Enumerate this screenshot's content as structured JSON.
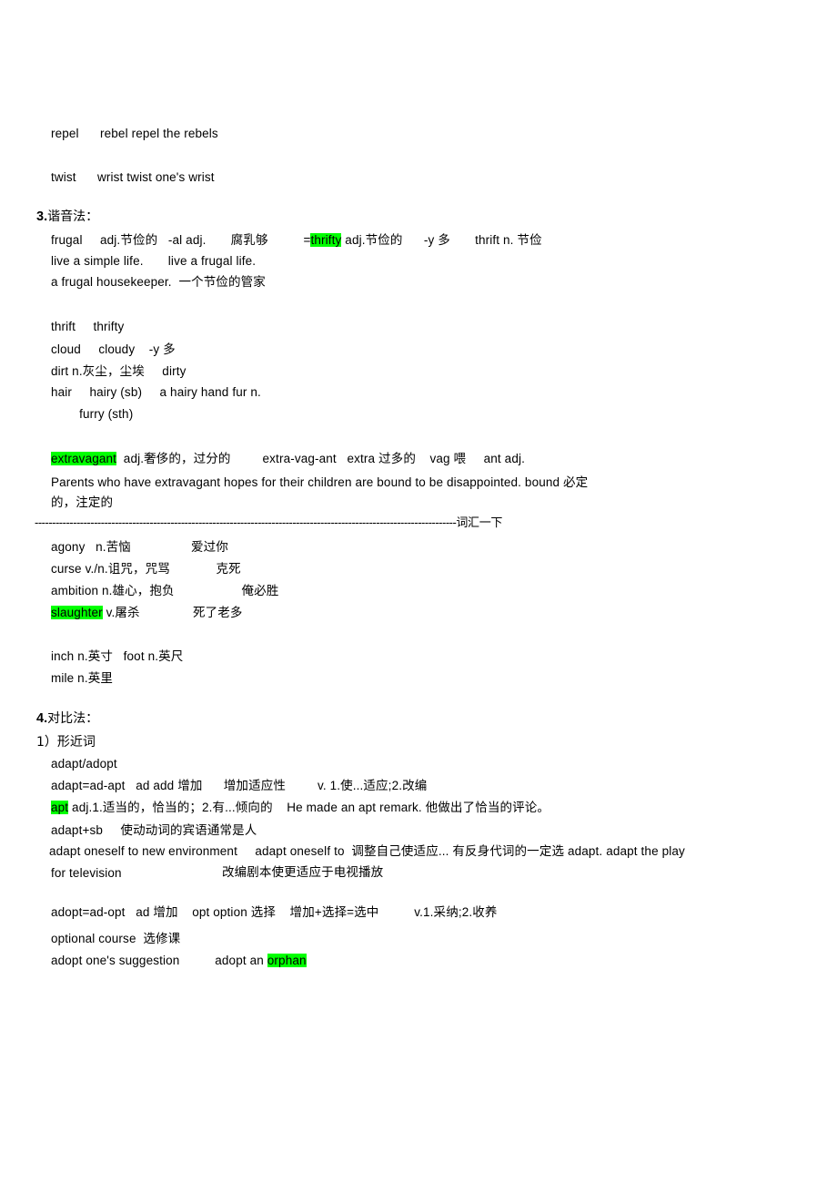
{
  "document": {
    "highlight_color": "#00ff00",
    "background": "#ffffff",
    "text_color": "#000000"
  },
  "lines": {
    "repel": "repel      rebel repel the rebels",
    "twist": "twist      wrist twist one's wrist",
    "heading3_num": "3.",
    "heading3_text": "谐音法：",
    "frugal_1a": "frugal     adj.节俭的   -al adj.       腐乳够          =",
    "frugal_1b": "thrifty",
    "frugal_1c": " adj.节俭的      -y 多       thrift n. 节俭",
    "frugal_2": "live a simple life.       live a frugal life.",
    "frugal_3": "a frugal housekeeper.  一个节俭的管家",
    "thrift_row": "thrift     thrifty",
    "cloud_row": "cloud     cloudy    -y 多",
    "dirt_row": "dirt n.灰尘，尘埃     dirty",
    "hair_row": "hair     hairy (sb)     a hairy hand fur n.",
    "furry_row": "        furry (sth)",
    "extravagant_hl": "extravagant",
    "extravagant_rest": "  adj.奢侈的，过分的         extra-vag-ant   extra 过多的    vag 喂     ant adj.",
    "extravagant_sent": "Parents who have extravagant hopes for their children are bound to be disappointed. bound 必定",
    "extravagant_sent2": "的，注定的",
    "separator_dashes": "-------------------------------------------------------------------------------------------------------------------------",
    "separator_label": "词汇一下",
    "agony": "agony   n.苦恼                 爱过你",
    "curse": "curse v./n.诅咒，咒骂             克死",
    "ambition": "ambition n.雄心，抱负                   俺必胜",
    "slaughter_hl": "slaughter",
    "slaughter_rest": " v.屠杀               死了老多",
    "inch": "inch n.英寸   foot n.英尺",
    "mile": "mile n.英里",
    "heading4_num": "4.",
    "heading4_text": "对比法：",
    "sub1": "1）形近词",
    "adapt_adopt": "adapt/adopt",
    "adapt_eq": "adapt=ad-apt   ad add 增加      增加适应性         v. 1.使...适应;2.改编",
    "apt_hl": "apt",
    "apt_rest": " adj.1.适当的，恰当的；2.有...倾向的    He made an apt remark. 他做出了恰当的评论。",
    "adapt_sb": "adapt+sb     使动动词的宾语通常是人",
    "adapt_oneself": "adapt oneself to new environment     adapt oneself to  调整自己使适应... 有反身代词的一定选 adapt. adapt the play",
    "for_television_a": "for television",
    "for_television_b": "改编剧本使更适应于电视播放",
    "adopt_eq": "adopt=ad-opt   ad 增加    opt option 选择    增加+选择=选中          v.1.采纳;2.收养",
    "optional_course": "optional course  选修课",
    "adopt_suggestion_a": "adopt one's suggestion          adopt an ",
    "orphan_hl": "orphan"
  }
}
